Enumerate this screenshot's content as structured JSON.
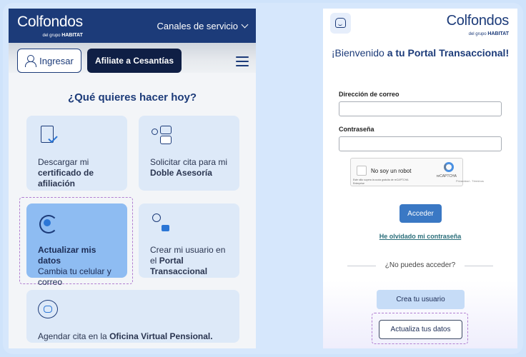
{
  "left": {
    "brand": {
      "name": "Colfondos",
      "tag_prefix": "del grupo",
      "tag_brand": "HABITAT"
    },
    "header": {
      "channels_label": "Canales de servicio"
    },
    "actions": {
      "login_label": "Ingresar",
      "join_label": "Afiliate a Cesantías"
    },
    "question": "¿Qué quieres hacer hoy?",
    "cards": [
      {
        "line1": "Descargar mi",
        "bold": "certificado de afiliación"
      },
      {
        "line1": "Solicitar cita para mi",
        "bold": "Doble Asesoría"
      },
      {
        "bold": "Actualizar mis datos",
        "line2": "Cambia tu celular y correo"
      },
      {
        "line1": "Crear mi usuario en el",
        "bold": "Portal Transaccional"
      },
      {
        "line1": "Agendar cita en la",
        "bold": "Oficina Virtual Pensional."
      }
    ]
  },
  "right": {
    "brand": {
      "name": "Colfondos",
      "tag_prefix": "del grupo",
      "tag_brand": "HABITAT"
    },
    "welcome": {
      "prefix": "¡Bienvenido",
      "bold_part": "a tu Portal Transaccional!"
    },
    "form": {
      "email_label": "Dirección de correo",
      "password_label": "Contraseña"
    },
    "recaptcha": {
      "label": "No soy un robot",
      "brand": "reCAPTCHA",
      "fineprint": "Este sitio supera la cuota gratuita de reCAPTCHA Enterprise",
      "privacy": "Privacidad - Términos"
    },
    "submit_label": "Acceder",
    "forgot_label": "He olvidado mi contraseña",
    "cant_access": "¿No puedes acceder?",
    "create_user_label": "Crea tu usuario",
    "update_data_label": "Actualiza tus datos"
  }
}
